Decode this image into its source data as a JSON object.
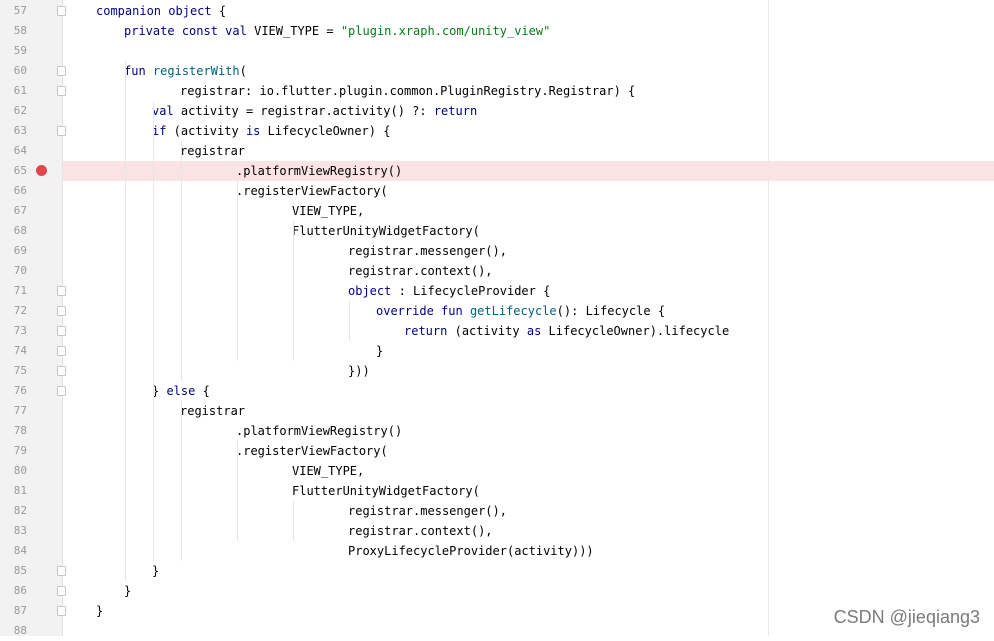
{
  "editor": {
    "lines": [
      {
        "n": "57",
        "text": "companion object {",
        "indent": 0
      },
      {
        "n": "58",
        "text": "private const val VIEW_TYPE = \"plugin.xraph.com/unity_view\"",
        "indent": 1
      },
      {
        "n": "59",
        "text": "",
        "indent": 0
      },
      {
        "n": "60",
        "text": "fun registerWith(",
        "indent": 1
      },
      {
        "n": "61",
        "text": "registrar: io.flutter.plugin.common.PluginRegistry.Registrar) {",
        "indent": 3
      },
      {
        "n": "62",
        "text": "val activity = registrar.activity() ?: return",
        "indent": 2
      },
      {
        "n": "63",
        "text": "if (activity is LifecycleOwner) {",
        "indent": 2
      },
      {
        "n": "64",
        "text": "registrar",
        "indent": 3
      },
      {
        "n": "65",
        "text": ".platformViewRegistry()",
        "indent": 5,
        "breakpoint": true
      },
      {
        "n": "66",
        "text": ".registerViewFactory(",
        "indent": 5
      },
      {
        "n": "67",
        "text": "VIEW_TYPE,",
        "indent": 7
      },
      {
        "n": "68",
        "text": "FlutterUnityWidgetFactory(",
        "indent": 7
      },
      {
        "n": "69",
        "text": "registrar.messenger(),",
        "indent": 9
      },
      {
        "n": "70",
        "text": "registrar.context(),",
        "indent": 9
      },
      {
        "n": "71",
        "text": "object : LifecycleProvider {",
        "indent": 9
      },
      {
        "n": "72",
        "text": "override fun getLifecycle(): Lifecycle {",
        "indent": 10
      },
      {
        "n": "73",
        "text": "return (activity as LifecycleOwner).lifecycle",
        "indent": 11
      },
      {
        "n": "74",
        "text": "}",
        "indent": 10
      },
      {
        "n": "75",
        "text": "}))",
        "indent": 9
      },
      {
        "n": "76",
        "text": "} else {",
        "indent": 2
      },
      {
        "n": "77",
        "text": "registrar",
        "indent": 3
      },
      {
        "n": "78",
        "text": ".platformViewRegistry()",
        "indent": 5
      },
      {
        "n": "79",
        "text": ".registerViewFactory(",
        "indent": 5
      },
      {
        "n": "80",
        "text": "VIEW_TYPE,",
        "indent": 7
      },
      {
        "n": "81",
        "text": "FlutterUnityWidgetFactory(",
        "indent": 7
      },
      {
        "n": "82",
        "text": "registrar.messenger(),",
        "indent": 9
      },
      {
        "n": "83",
        "text": "registrar.context(),",
        "indent": 9
      },
      {
        "n": "84",
        "text": "ProxyLifecycleProvider(activity)))",
        "indent": 9
      },
      {
        "n": "85",
        "text": "}",
        "indent": 2
      },
      {
        "n": "86",
        "text": "}",
        "indent": 1
      },
      {
        "n": "87",
        "text": "}",
        "indent": 0
      },
      {
        "n": "88",
        "text": "",
        "indent": 0
      }
    ],
    "fold_lines": [
      "57",
      "60",
      "61",
      "63",
      "71",
      "72",
      "73",
      "74",
      "75",
      "76",
      "85",
      "86",
      "87"
    ],
    "colors": {
      "keyword": "#000080",
      "string": "#067d17",
      "function": "#00627a",
      "breakpoint": "#e0474c",
      "breakpoint_line": "#fae3e3"
    }
  },
  "watermark": "CSDN @jieqiang3"
}
